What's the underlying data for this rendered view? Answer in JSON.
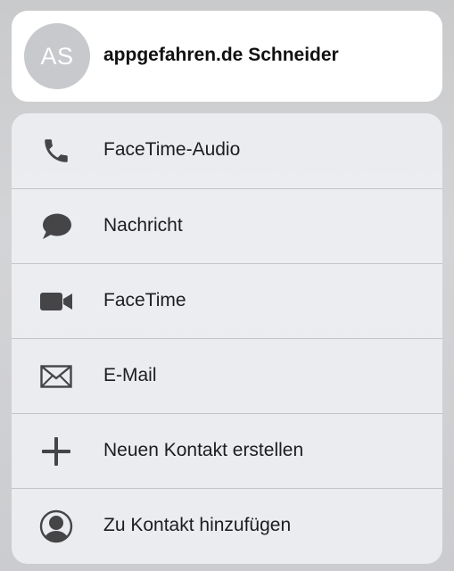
{
  "contact": {
    "initials": "AS",
    "name": "appgefahren.de Schneider"
  },
  "actions": [
    {
      "label": "FaceTime-Audio",
      "icon": "phone-icon"
    },
    {
      "label": "Nachricht",
      "icon": "message-bubble-icon"
    },
    {
      "label": "FaceTime",
      "icon": "video-camera-icon"
    },
    {
      "label": "E-Mail",
      "icon": "envelope-icon"
    },
    {
      "label": "Neuen Kontakt erstellen",
      "icon": "plus-icon"
    },
    {
      "label": "Zu Kontakt hinzufügen",
      "icon": "person-circle-icon"
    }
  ],
  "colors": {
    "icon": "#454548",
    "text": "#1d1d1f",
    "avatar": "#c8c9cd"
  }
}
